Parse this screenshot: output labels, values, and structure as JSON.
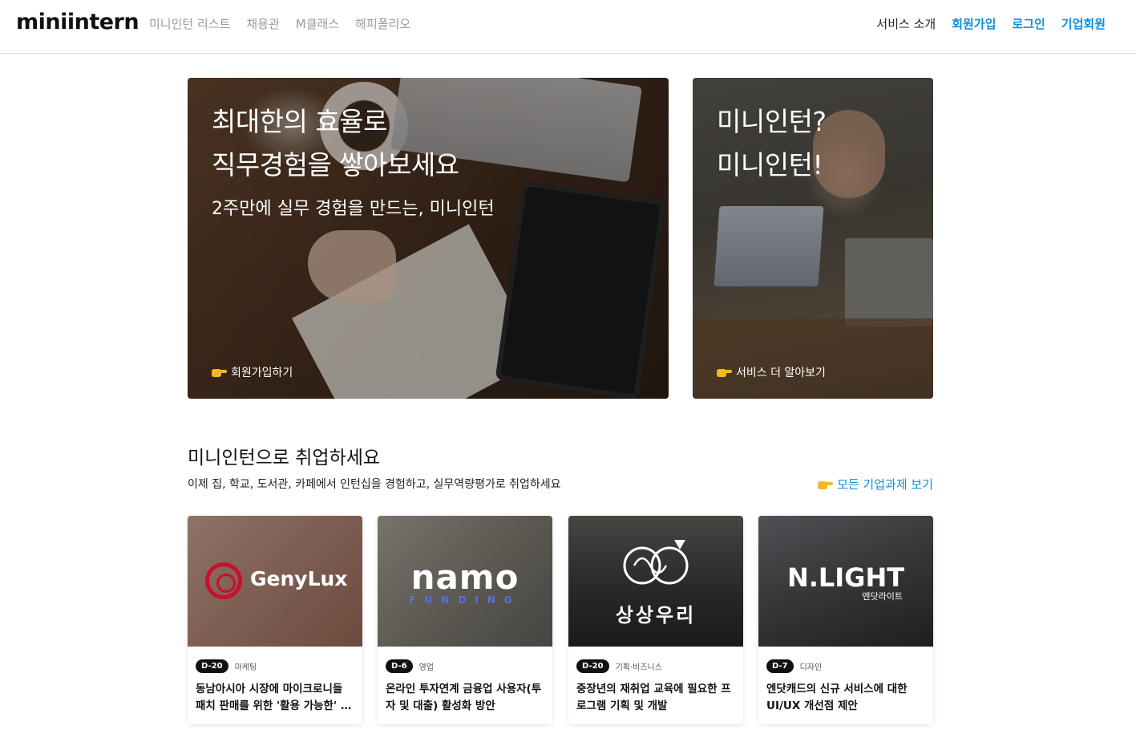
{
  "header": {
    "logo": "miniintern",
    "nav_left": [
      "미니인턴 리스트",
      "채용관",
      "M클래스",
      "해피폴리오"
    ],
    "nav_right": {
      "service": "서비스 소개",
      "signup": "회원가입",
      "login": "로그인",
      "corporate": "기업회원"
    }
  },
  "banners": {
    "main": {
      "title_line1": "최대한의 효율로",
      "title_line2": "직무경험을 쌓아보세요",
      "subtitle": "2주만에 실무 경험을 만드는, 미니인턴",
      "cta": "회원가입하기"
    },
    "side": {
      "title_line1": "미니인턴?",
      "title_line2": "미니인턴!",
      "cta": "서비스 더 알아보기"
    }
  },
  "section": {
    "title": "미니인턴으로 취업하세요",
    "description": "이제 집, 학교, 도서관, 카페에서 인턴십을 경험하고, 실무역량평가로 취업하세요",
    "all_link": "모든 기업과제 보기"
  },
  "cards": [
    {
      "logo": "GenyLux",
      "dday": "D-20",
      "category": "마케팅",
      "title": "동남아시아 시장에 마이크로니들 패치 판매를 위한 '활용 가능한' 전략 수립"
    },
    {
      "logo": "namo",
      "logo_sub": "FUNDING",
      "dday": "D-6",
      "category": "영업",
      "title": "온라인 투자연계 금융업 사용자(투자 및 대출) 활성화 방안"
    },
    {
      "logo": "상상우리",
      "dday": "D-20",
      "category": "기획·비즈니스",
      "title": "중장년의 재취업 교육에 필요한 프로그램 기획 및 개발"
    },
    {
      "logo": "N.LIGHT",
      "logo_sub": "엔닷라이트",
      "dday": "D-7",
      "category": "디자인",
      "title": "엔닷캐드의 신규 서비스에 대한 UI/UX 개선점 제안"
    }
  ],
  "colors": {
    "accent_blue": "#0b8fe0",
    "badge_black": "#111111",
    "pointer_icon": "#f5b728"
  }
}
